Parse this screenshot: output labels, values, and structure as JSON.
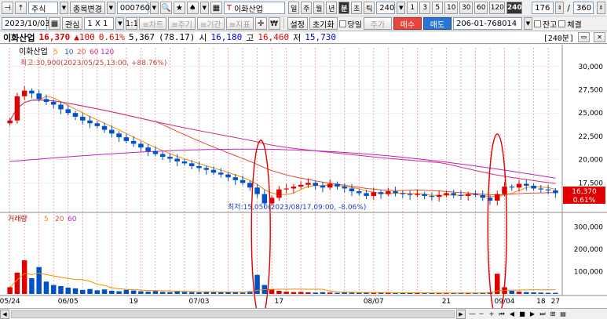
{
  "toolbar1": {
    "market": "주식",
    "change_item": "종목변경",
    "code": "000760",
    "stock_name": "이화산업",
    "periods": [
      "일",
      "주",
      "월",
      "년",
      "분",
      "초",
      "틱"
    ],
    "period_value": "240",
    "timeframes": [
      "1",
      "3",
      "5",
      "10",
      "30",
      "60",
      "120",
      "240"
    ],
    "active_timeframe": "240",
    "count": "176",
    "total": "360"
  },
  "toolbar2": {
    "date": "2023/10/03",
    "watch": "관심",
    "ratio": "1 X 1",
    "chart_btn": "≡차트",
    "period_btn": "≡주기",
    "range_btn": "≡기간",
    "indicator_btn": "≡지표",
    "settings": "설정",
    "reset": "초기화",
    "same_day": "당일",
    "price_btn": "주가",
    "buy": "매수",
    "sell": "매도",
    "account": "206-01-768014",
    "balance": "잔고",
    "fill": "체결"
  },
  "quote": {
    "name": "이화산업",
    "price": "16,370",
    "change": "▲100",
    "pct": "0.61%",
    "volume": "5,367",
    "vol_pct": "(78.17)",
    "open_label": "시",
    "open": "16,180",
    "high_label": "고",
    "high": "16,460",
    "low_label": "저",
    "low": "15,730",
    "period_tag": "[240분]"
  },
  "price_legend": {
    "name": "이화산업",
    "ma": [
      "5",
      "10",
      "20",
      "60",
      "120"
    ],
    "max_note": "최고:30,900(2023/05/25,13:00, +88.76%)",
    "min_note": "최저:15,050(2023/08/17,09:00, -8.06%)",
    "current_label": "16,370",
    "current_pct": "0.61%"
  },
  "volume_legend": {
    "name": "거래량",
    "ma": [
      "5",
      "20",
      "60"
    ]
  },
  "colors": {
    "up": "#e00000",
    "down": "#0050c8",
    "ma5": "#f08c00",
    "ma20": "#e0503c",
    "ma60": "#d02e80",
    "ma120": "#c020c0",
    "grid": "#e06060",
    "highlight": "#e00000"
  },
  "chart_data": {
    "type": "candlestick",
    "price_axis": [
      "30,000",
      "27,500",
      "25,000",
      "22,500",
      "20,000",
      "17,500"
    ],
    "price_ylim": [
      14500,
      32000
    ],
    "volume_axis": [
      "300,000",
      "200,000",
      "100,000"
    ],
    "volume_ylim": [
      0,
      350000
    ],
    "x_labels": [
      "05/24",
      "06/05",
      "19",
      "07/03",
      "17",
      "08/07",
      "21",
      "09/04",
      "18",
      "27"
    ],
    "close_series": [
      24200,
      26800,
      27400,
      27100,
      26500,
      26200,
      25900,
      25400,
      25000,
      24600,
      24200,
      23900,
      23600,
      23200,
      22800,
      22400,
      22000,
      21700,
      21300,
      20900,
      20600,
      20300,
      20100,
      19800,
      19600,
      19300,
      19100,
      18900,
      18600,
      18400,
      18100,
      17800,
      17500,
      17000,
      16300,
      15300,
      15900,
      16800,
      16900,
      17100,
      17300,
      17500,
      17200,
      17000,
      17400,
      17100,
      16900,
      16600,
      16400,
      16100,
      16500,
      16300,
      16600,
      16400,
      16300,
      16200,
      16300,
      16100,
      16000,
      16200,
      16400,
      16200,
      16100,
      16300,
      16200,
      15900,
      15600,
      16300,
      17100,
      17000,
      17400,
      17200,
      16900,
      16800,
      16700,
      16400
    ],
    "volume_series": [
      30000,
      95000,
      150000,
      70000,
      120000,
      55000,
      40000,
      35000,
      28000,
      25000,
      18000,
      22000,
      16000,
      20000,
      14000,
      12000,
      18000,
      15000,
      12000,
      10000,
      13000,
      9000,
      8000,
      11000,
      9000,
      8000,
      7000,
      10000,
      8000,
      7000,
      9000,
      8000,
      6000,
      12000,
      85000,
      40000,
      20000,
      14000,
      10000,
      8000,
      9000,
      7000,
      6000,
      8000,
      6000,
      5000,
      7000,
      6000,
      5000,
      6000,
      5000,
      6000,
      5000,
      4000,
      5000,
      4000,
      5000,
      4000,
      5000,
      4000,
      5000,
      4000,
      4000,
      5000,
      4000,
      6000,
      8000,
      90000,
      30000,
      14000,
      10000,
      8000,
      7000,
      6000,
      5000,
      5000
    ],
    "annotations": [
      "ellipse around 08/17 low-volume spike",
      "ellipse around 09/13 breakout spike"
    ]
  },
  "bottom": {
    "zoom_label": "—"
  }
}
